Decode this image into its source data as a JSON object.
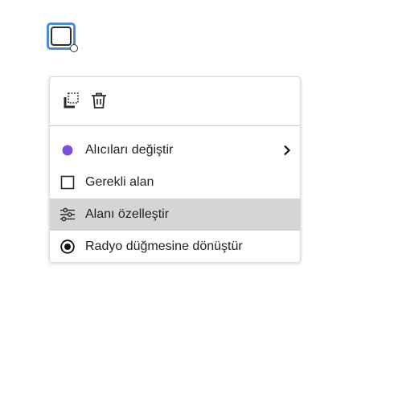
{
  "field": {
    "selected_color": "#4a8bd6"
  },
  "menu": {
    "toolbar": {
      "duplicate_icon": "duplicate-icon",
      "delete_icon": "trash-icon"
    },
    "items": [
      {
        "label": "Alıcıları değiştir",
        "icon": "purple-dot-icon",
        "icon_color": "#7b4fe0",
        "has_submenu": true
      },
      {
        "label": "Gerekli alan",
        "icon": "checkbox-icon",
        "has_submenu": false
      },
      {
        "label": "Alanı özelleştir",
        "icon": "sliders-icon",
        "has_submenu": false,
        "highlighted": true
      },
      {
        "label": "Radyo düğmesine dönüştür",
        "icon": "radio-button-icon",
        "has_submenu": false
      }
    ],
    "highlight_color": "#d5d5d5"
  }
}
